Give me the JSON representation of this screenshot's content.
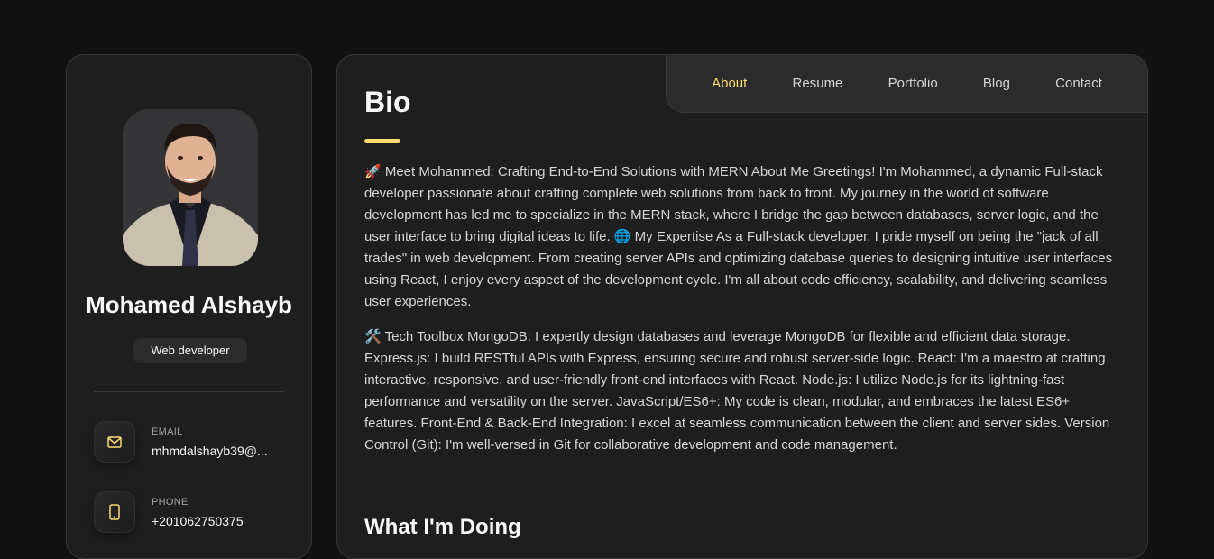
{
  "profile": {
    "name": "Mohamed Alshayb",
    "title": "Web developer",
    "avatar_icon": "profile-photo"
  },
  "contacts": [
    {
      "icon": "mail-icon",
      "label": "EMAIL",
      "value": "mhmdalshayb39@..."
    },
    {
      "icon": "phone-icon",
      "label": "PHONE",
      "value": "+201062750375"
    }
  ],
  "nav": {
    "items": [
      "About",
      "Resume",
      "Portfolio",
      "Blog",
      "Contact"
    ],
    "active": "About"
  },
  "about": {
    "title": "Bio",
    "paragraph1": "🚀 Meet Mohammed: Crafting End-to-End Solutions with MERN About Me Greetings! I'm Mohammed, a dynamic Full-stack developer passionate about crafting complete web solutions from back to front. My journey in the world of software development has led me to specialize in the MERN stack, where I bridge the gap between databases, server logic, and the user interface to bring digital ideas to life. 🌐 My Expertise As a Full-stack developer, I pride myself on being the \"jack of all trades\" in web development. From creating server APIs and optimizing database queries to designing intuitive user interfaces using React, I enjoy every aspect of the development cycle. I'm all about code efficiency, scalability, and delivering seamless user experiences.",
    "paragraph2": "🛠️ Tech Toolbox MongoDB: I expertly design databases and leverage MongoDB for flexible and efficient data storage. Express.js: I build RESTful APIs with Express, ensuring secure and robust server-side logic. React: I'm a maestro at crafting interactive, responsive, and user-friendly front-end interfaces with React. Node.js: I utilize Node.js for its lightning-fast performance and versatility on the server. JavaScript/ES6+: My code is clean, modular, and embraces the latest ES6+ features. Front-End & Back-End Integration: I excel at seamless communication between the client and server sides. Version Control (Git): I'm well-versed in Git for collaborative development and code management.",
    "doing_title": "What I'm Doing"
  },
  "colors": {
    "accent": "#ffdb70",
    "background": "#121212",
    "card": "#1e1e1f",
    "nav_bg": "#2b2b2c"
  }
}
